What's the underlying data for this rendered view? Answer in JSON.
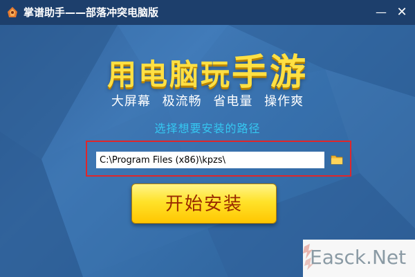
{
  "window": {
    "title": "掌谱助手——部落冲突电脑版",
    "minimize_label": "—",
    "close_label": "✕"
  },
  "banner": {
    "headline_part1": "用电脑玩",
    "headline_part2": "手游",
    "features": "大屏幕 极流畅 省电量 操作爽"
  },
  "install": {
    "prompt": "选择想要安装的路径",
    "path_value": "C:\\Program Files (x86)\\kpzs\\",
    "button_label": "开始安装"
  },
  "watermark": {
    "text": "Easck.Net"
  },
  "colors": {
    "title_bar": "#1d3f6c",
    "background": "#3a6fae",
    "headline": "#ffe043",
    "prompt": "#35c8f2",
    "highlight_frame": "#e0262a",
    "button": "#ffd21f"
  },
  "icons": {
    "app": "app-logo-icon",
    "folder": "folder-icon",
    "minimize": "minimize-icon",
    "close": "close-icon"
  }
}
